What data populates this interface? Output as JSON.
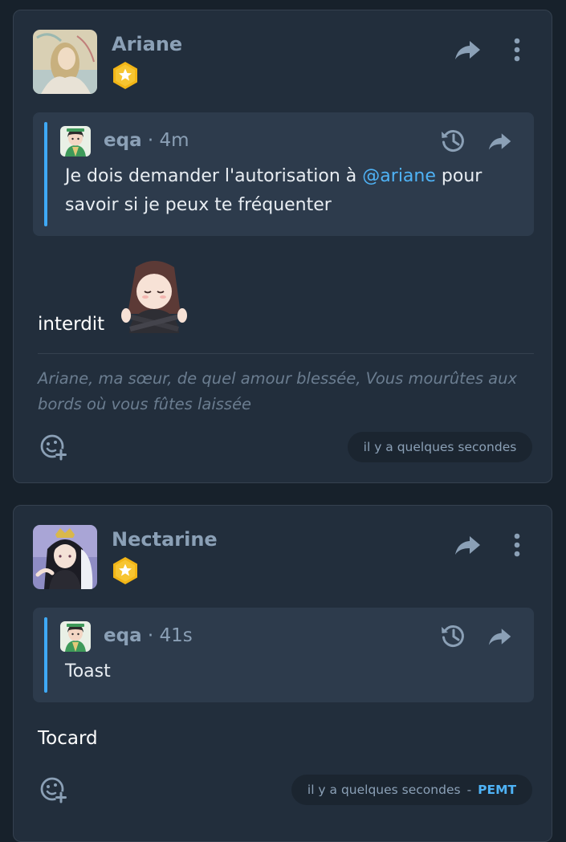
{
  "posts": [
    {
      "author": "Ariane",
      "quote": {
        "author": "eqa",
        "time": "4m",
        "text_before": "Je dois demander l'autorisation à ",
        "mention": "@ariane",
        "text_after": " pour savoir si je peux te fréquenter"
      },
      "body": "interdit",
      "sticker": "crossed-arms-girl-sticker",
      "signature": "Ariane, ma sœur, de quel amour blessée, Vous mourûtes aux bords où vous fûtes laissée",
      "time": "il y a quelques secondes"
    },
    {
      "author": "Nectarine",
      "quote": {
        "author": "eqa",
        "time": "41s",
        "text": "Toast"
      },
      "body": "Tocard",
      "time": "il y a quelques secondes",
      "separator": "-",
      "visibility": "PEMT"
    }
  ],
  "colors": {
    "background": "#17212b",
    "card": "#222e3c",
    "quote": "#2d3b4c",
    "accent": "#3fa9f5",
    "muted": "#8ba0b6",
    "badge": "#f2b516"
  },
  "icons": {
    "badge": "star-badge-icon",
    "share": "share-arrow-icon",
    "more": "more-vertical-icon",
    "history": "history-icon",
    "react": "add-reaction-icon"
  }
}
